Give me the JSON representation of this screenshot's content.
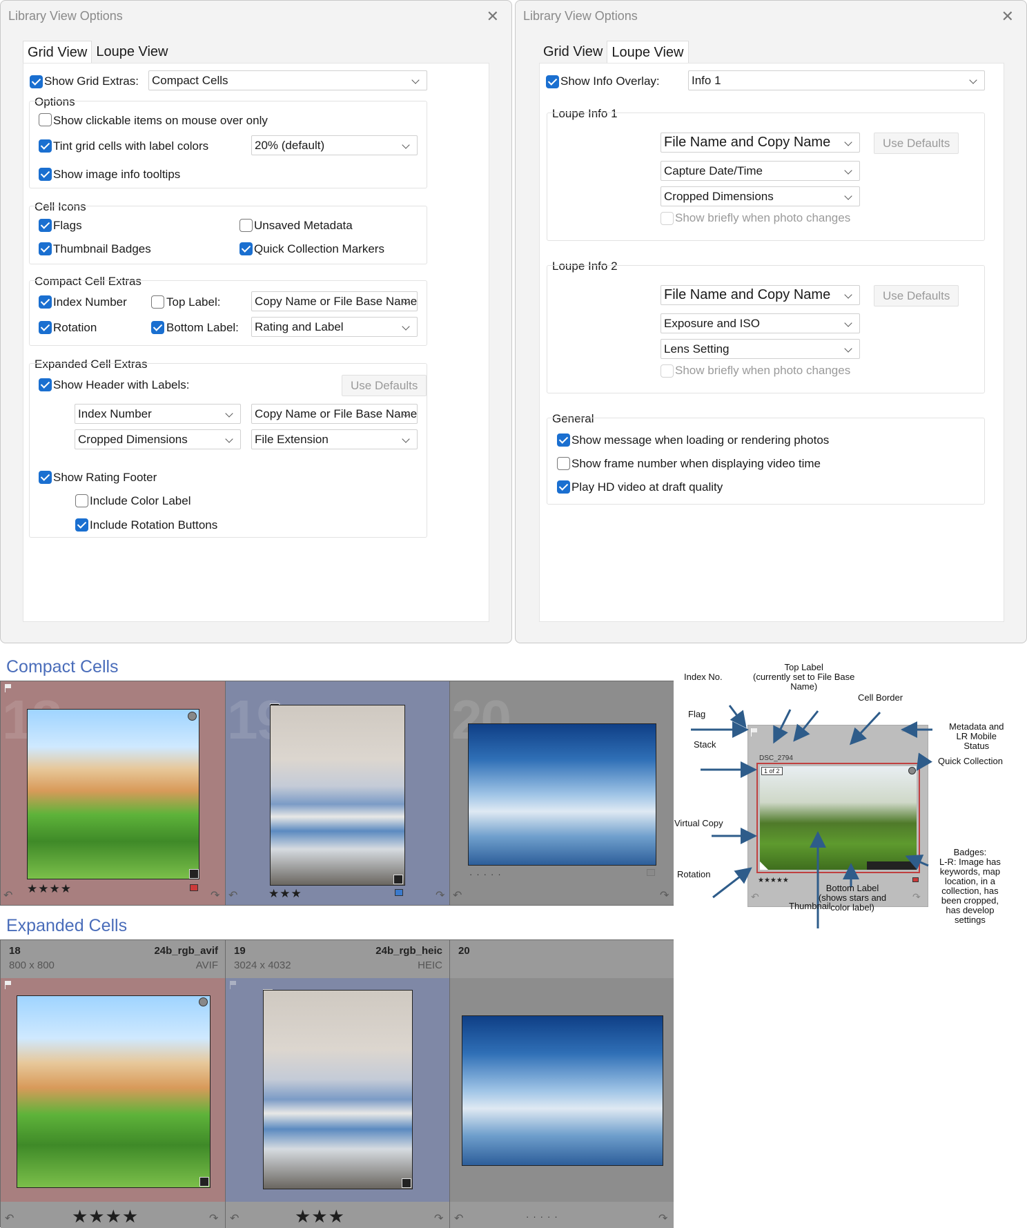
{
  "window": {
    "title": "Library View Options",
    "close_icon": "close-icon"
  },
  "tabs": {
    "grid": "Grid View",
    "loupe": "Loupe View"
  },
  "grid": {
    "show_grid_extras": {
      "label": "Show Grid Extras:",
      "checked": true,
      "value": "Compact Cells"
    },
    "options": {
      "title": "Options",
      "clickable": {
        "label": "Show clickable items on mouse over only",
        "checked": false
      },
      "tint": {
        "label": "Tint grid cells with label colors",
        "checked": true,
        "value": "20% (default)"
      },
      "tooltips": {
        "label": "Show image info tooltips",
        "checked": true
      }
    },
    "cell_icons": {
      "title": "Cell Icons",
      "flags": {
        "label": "Flags",
        "checked": true
      },
      "unsaved": {
        "label": "Unsaved Metadata",
        "checked": false
      },
      "badges": {
        "label": "Thumbnail Badges",
        "checked": true
      },
      "quick": {
        "label": "Quick Collection Markers",
        "checked": true
      }
    },
    "compact": {
      "title": "Compact Cell Extras",
      "index": {
        "label": "Index Number",
        "checked": true
      },
      "top_label": {
        "label": "Top Label:",
        "checked": false,
        "value": "Copy Name or File Base Name"
      },
      "rotation": {
        "label": "Rotation",
        "checked": true
      },
      "bottom_label": {
        "label": "Bottom Label:",
        "checked": true,
        "value": "Rating and Label"
      }
    },
    "expanded": {
      "title": "Expanded Cell Extras",
      "header": {
        "label": "Show Header with Labels:",
        "checked": true
      },
      "use_defaults": "Use Defaults",
      "dd1": "Index Number",
      "dd2": "Copy Name or File Base Name",
      "dd3": "Cropped Dimensions",
      "dd4": "File Extension",
      "footer": {
        "label": "Show Rating Footer",
        "checked": true
      },
      "color_label": {
        "label": "Include Color Label",
        "checked": false
      },
      "rot_buttons": {
        "label": "Include Rotation Buttons",
        "checked": true
      }
    }
  },
  "loupe": {
    "overlay": {
      "label": "Show Info Overlay:",
      "checked": true,
      "value": "Info 1"
    },
    "info1": {
      "title": "Loupe Info 1",
      "dd1": "File Name and Copy Name",
      "dd2": "Capture Date/Time",
      "dd3": "Cropped Dimensions",
      "use_defaults": "Use Defaults",
      "briefly": {
        "label": "Show briefly when photo changes",
        "checked": false
      }
    },
    "info2": {
      "title": "Loupe Info 2",
      "dd1": "File Name and Copy Name",
      "dd2": "Exposure and ISO",
      "dd3": "Lens Setting",
      "use_defaults": "Use Defaults",
      "briefly": {
        "label": "Show briefly when photo changes",
        "checked": false
      }
    },
    "general": {
      "title": "General",
      "loading": {
        "label": "Show message when loading or rendering photos",
        "checked": true
      },
      "frame": {
        "label": "Show frame number when displaying video time",
        "checked": false
      },
      "hd": {
        "label": "Play HD video at draft quality",
        "checked": true
      }
    }
  },
  "compact_cells": {
    "title": "Compact Cells",
    "cells": [
      {
        "index": "18",
        "stars": "★★★★",
        "color": "#cc3b3b",
        "bg": "#a87f7f"
      },
      {
        "index": "19",
        "stars": "★★★",
        "color": "#3b7acc",
        "bg": "#7f88a6"
      },
      {
        "index": "20",
        "stars": "",
        "color": "#8a8a8a",
        "bg": "#8d8d8d"
      }
    ]
  },
  "expanded_cells": {
    "title": "Expanded Cells",
    "cells": [
      {
        "index": "18",
        "name": "24b_rgb_avif",
        "dims": "800 x 800",
        "ext": "AVIF",
        "stars": "★★★★",
        "bg": "#a87f7f"
      },
      {
        "index": "19",
        "name": "24b_rgb_heic",
        "dims": "3024 x 4032",
        "ext": "HEIC",
        "stars": "★★★",
        "bg": "#7f88a6"
      },
      {
        "index": "20",
        "name": "",
        "dims": "",
        "ext": "",
        "stars": "",
        "bg": "#8d8d8d"
      }
    ]
  },
  "diagram": {
    "index_no": "Index No.",
    "top_label": "Top Label\n(currently set to File Base\nName)",
    "cell_border": "Cell Border",
    "flag": "Flag",
    "metadata": "Metadata and\nLR Mobile\nStatus",
    "stack": "Stack",
    "quick": "Quick Collection",
    "virtual": "Virtual Copy",
    "badges": "Badges:\nL-R: Image has\nkeywords, map\nlocation, in a\ncollection, has\nbeen cropped,\nhas develop\nsettings",
    "rotation": "Rotation",
    "bottom": "Bottom Label\n(shows stars and\ncolor label)",
    "thumbnail": "Thumbnail",
    "file_label": "DSC_2794",
    "stack_badge": "1 of 2",
    "stars": "★★★★★"
  }
}
